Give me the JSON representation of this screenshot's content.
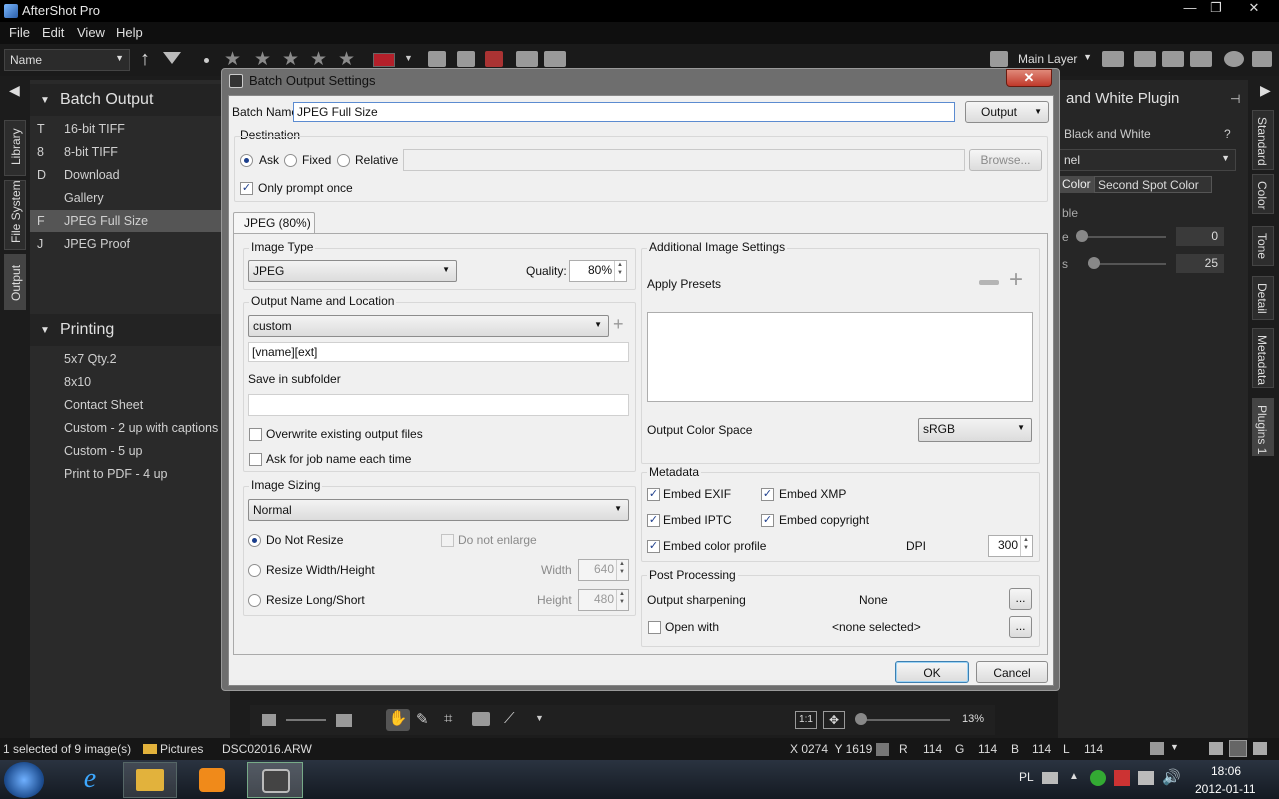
{
  "app": {
    "title": "AfterShot Pro",
    "win_minimize": "—",
    "win_maximize": "❐",
    "win_close": "✕"
  },
  "menu": [
    "File",
    "Edit",
    "View",
    "Help"
  ],
  "toolbar": {
    "sort_by": "Name",
    "layer": "Main Layer"
  },
  "left_panel": {
    "tabs": [
      "Library",
      "File System",
      "Output"
    ],
    "batch_output": {
      "title": "Batch Output",
      "items": [
        {
          "key": "T",
          "label": "16-bit TIFF"
        },
        {
          "key": "8",
          "label": "8-bit TIFF"
        },
        {
          "key": "D",
          "label": "Download"
        },
        {
          "key": "",
          "label": "Gallery"
        },
        {
          "key": "F",
          "label": "JPEG Full Size"
        },
        {
          "key": "J",
          "label": "JPEG Proof"
        }
      ]
    },
    "printing": {
      "title": "Printing",
      "items": [
        "5x7 Qty.2",
        "8x10",
        "Contact Sheet",
        "Custom - 2 up with captions",
        "Custom - 5 up",
        "Print to PDF - 4 up"
      ]
    }
  },
  "right_panel": {
    "title": "and White Plugin",
    "tabs": [
      "Standard",
      "Color",
      "Tone",
      "Detail",
      "Metadata",
      "Plugins 1"
    ],
    "plugin_label": "Black and White",
    "help": "?",
    "select": "nel",
    "subtabs": [
      "Color",
      "Second Spot Color"
    ],
    "row_label": "ble",
    "slider1_label": "e",
    "slider1_value": "0",
    "slider2_label": "s",
    "slider2_value": "25"
  },
  "dialog": {
    "title": "Batch Output Settings",
    "batch_name_label": "Batch Name",
    "batch_name": "JPEG Full Size",
    "output_button": "Output",
    "destination_label": "Destination",
    "dest_ask": "Ask",
    "dest_fixed": "Fixed",
    "dest_relative": "Relative",
    "browse_button": "Browse...",
    "only_prompt_once": "Only prompt once",
    "format_tab": "JPEG (80%)",
    "image_type_label": "Image Type",
    "image_type": "JPEG",
    "quality_label": "Quality:",
    "quality": "80%",
    "output_name_label": "Output Name and Location",
    "name_preset": "custom",
    "name_template": "[vname][ext]",
    "save_subfolder_label": "Save in subfolder",
    "subfolder": "",
    "overwrite": "Overwrite existing output files",
    "ask_job_name": "Ask for job name each time",
    "image_sizing_label": "Image Sizing",
    "sizing_mode": "Normal",
    "do_not_resize": "Do Not Resize",
    "do_not_enlarge": "Do not enlarge",
    "resize_wh": "Resize Width/Height",
    "width_label": "Width",
    "width": "640",
    "resize_ls": "Resize Long/Short",
    "height_label": "Height",
    "height": "480",
    "additional_label": "Additional Image Settings",
    "apply_presets": "Apply Presets",
    "color_space_label": "Output Color Space",
    "color_space": "sRGB",
    "metadata_label": "Metadata",
    "embed_exif": "Embed EXIF",
    "embed_xmp": "Embed XMP",
    "embed_iptc": "Embed IPTC",
    "embed_copyright": "Embed copyright",
    "embed_color_profile": "Embed color profile",
    "dpi_label": "DPI",
    "dpi": "300",
    "post_label": "Post Processing",
    "sharpening_label": "Output sharpening",
    "sharpening": "None",
    "open_with": "Open with",
    "open_with_value": "<none selected>",
    "ellipsis": "...",
    "ok": "OK",
    "cancel": "Cancel"
  },
  "bottom": {
    "selection": "1 selected of 9 image(s)",
    "folder": "Pictures",
    "file": "DSC02016.ARW",
    "coords": "X 0274  Y 1619",
    "r_label": "R",
    "r": "114",
    "g_label": "G",
    "g": "114",
    "b_label": "B",
    "b": "114",
    "l_label": "L",
    "l": "114",
    "zoom": "13%",
    "one_to_one": "1:1"
  },
  "taskbar": {
    "lang": "PL",
    "time": "18:06",
    "date": "2012-01-11"
  }
}
